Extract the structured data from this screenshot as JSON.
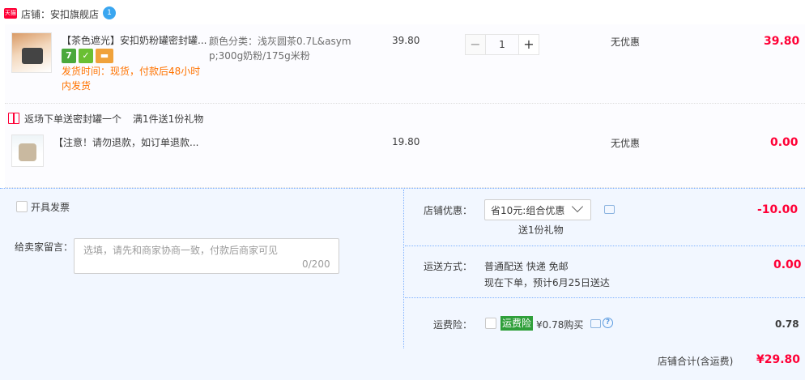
{
  "store": {
    "badge": "天猫",
    "label": "店铺：安扣旗舰店"
  },
  "items": [
    {
      "title": "【茶色遮光】安扣奶粉罐密封罐...",
      "tags": [
        "7",
        "shield",
        "card"
      ],
      "ship_note": "发货时间：现货，付款后48小时内发货",
      "sku": "颜色分类：浅灰圆茶0.7L&asymp;300g奶粉/175g米粉",
      "price": "39.80",
      "qty": "1",
      "discount": "无优惠",
      "subtotal": "39.80"
    },
    {
      "title": "【注意！请勿退款，如订单退款...",
      "price": "19.80",
      "discount": "无优惠",
      "subtotal": "0.00"
    }
  ],
  "gift": {
    "text": "返场下单送密封罐一个",
    "rule": "满1件送1份礼物"
  },
  "invoice": {
    "label": "开具发票"
  },
  "message": {
    "label": "给卖家留言：",
    "placeholder": "选填，请先和商家协商一致，付款后商家可见",
    "count": "0/200"
  },
  "promo": {
    "label": "店铺优惠：",
    "selected": "省10元:组合优惠",
    "sub": "送1份礼物",
    "amount": "-10.00"
  },
  "shipping": {
    "label": "运送方式：",
    "method": "普通配送 快递 免邮",
    "eta": "现在下单，预计6月25日送达",
    "amount": "0.00"
  },
  "insurance": {
    "label": "运费险：",
    "badge": "运费险",
    "price_text": "¥0.78购买",
    "amount": "0.78"
  },
  "total": {
    "label": "店铺合计(含运费)",
    "amount": "¥29.80"
  },
  "colors": {
    "accent_red": "#ff0036",
    "ship_orange": "#ff7300",
    "panel_bg": "#f2f7ff",
    "insurance_green": "#2f9f3a"
  }
}
